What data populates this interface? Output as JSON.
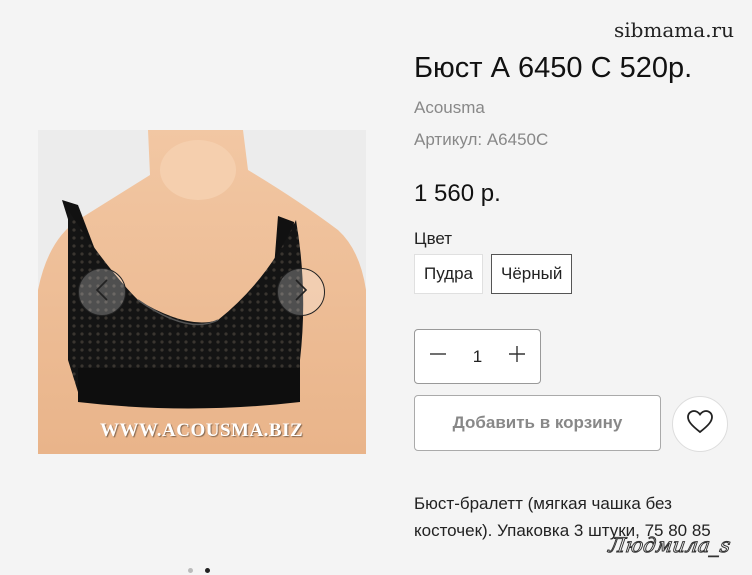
{
  "watermarks": {
    "top": "sibmama.ru",
    "bottom": "Людмила_s"
  },
  "gallery": {
    "image_caption": "WWW.ACOUSMA.BIZ",
    "prev_icon": "chevron-left-icon",
    "next_icon": "chevron-right-icon",
    "dots_total": 2,
    "active_dot": 2
  },
  "product": {
    "title": "Бюст А 6450 С 520р.",
    "brand": "Acousma",
    "sku": "Артикул: A6450C",
    "price": "1 560 р.",
    "color_label": "Цвет",
    "colors": [
      {
        "label": "Пудра",
        "selected": false
      },
      {
        "label": "Чёрный",
        "selected": true
      }
    ],
    "quantity": "1",
    "add_to_cart": "Добавить в корзину",
    "favorite_icon": "heart-icon",
    "description": "Бюст-бралетт (мягкая чашка без косточек). Упаковка 3 штуки, 75 80 85"
  },
  "colors": {
    "background": "#f4f4f4",
    "text": "#222222",
    "muted": "#888888"
  }
}
